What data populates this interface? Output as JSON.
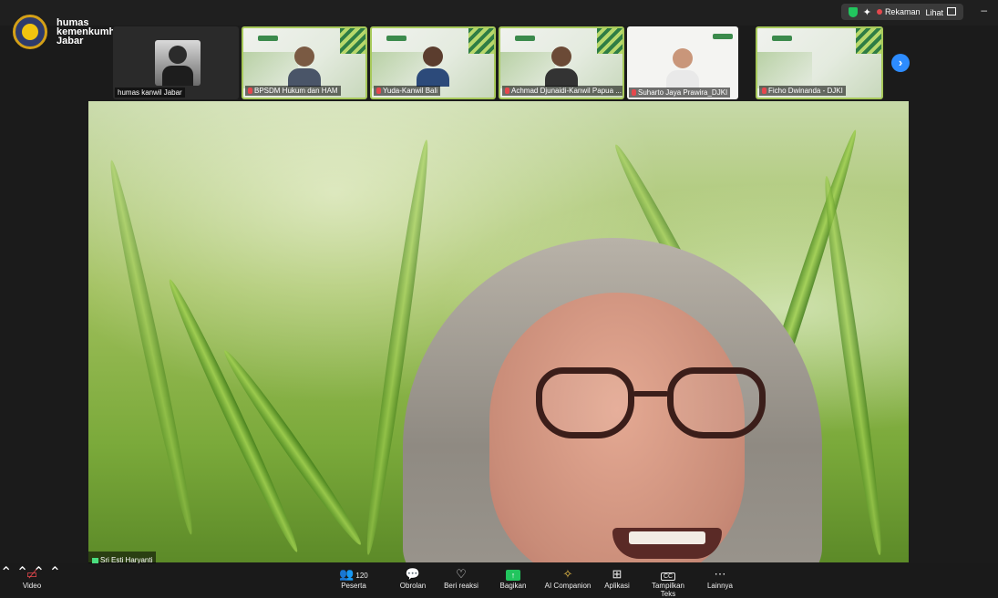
{
  "brand": {
    "line1": "humas",
    "line2": "kemenkumham",
    "line3": "Jabar"
  },
  "top": {
    "recording_label": "Rekaman",
    "view_label": "Lihat",
    "minimize_glyph": "–"
  },
  "participants": [
    {
      "name": "humas kanwil Jabar",
      "muted": false
    },
    {
      "name": "BPSDM Hukum dan HAM",
      "muted": true
    },
    {
      "name": "Yuda-Kanwil Bali",
      "muted": true
    },
    {
      "name": "Achmad Djunaidi-Kanwil Papua ...",
      "muted": true
    },
    {
      "name": "Suharto Jaya Prawira_DJKI",
      "muted": true
    },
    {
      "name": "Ficho Dwinanda - DJKI",
      "muted": true
    }
  ],
  "strip_next_glyph": "›",
  "active_speaker": {
    "name": "Sri Esti Haryanti"
  },
  "toolbar": {
    "video": {
      "label": "Video",
      "icon": "video-off-icon"
    },
    "participants": {
      "label": "Peserta",
      "count": "120"
    },
    "chat": {
      "label": "Obrolan"
    },
    "reactions": {
      "label": "Beri reaksi"
    },
    "share": {
      "label": "Bagikan"
    },
    "ai": {
      "label": "AI Companion"
    },
    "apps": {
      "label": "Aplikasi"
    },
    "captions": {
      "label": "Tampilkan Teks",
      "icon_text": "CC"
    },
    "more": {
      "label": "Lainnya"
    }
  },
  "colors": {
    "accent": "#2d8cff",
    "share": "#22c55e",
    "muted": "#e5484d"
  }
}
